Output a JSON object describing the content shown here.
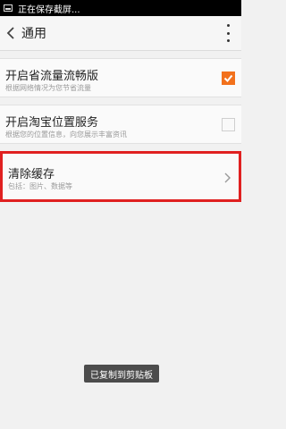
{
  "status_bar": {
    "text": "正在保存截屏..."
  },
  "app_bar": {
    "title": "通用"
  },
  "settings": {
    "items": [
      {
        "title": "开启省流量流畅版",
        "subtitle": "根据网络情况为您节省流量",
        "checked": true
      },
      {
        "title": "开启淘宝位置服务",
        "subtitle": "根据您的位置信息，向您展示丰富资讯",
        "checked": false
      },
      {
        "title": "清除缓存",
        "subtitle": "包括：图片、数据等"
      }
    ]
  },
  "toast": {
    "text": "已复制到剪贴板"
  },
  "colors": {
    "accent": "#f2711c",
    "highlight_border": "#e02020"
  }
}
